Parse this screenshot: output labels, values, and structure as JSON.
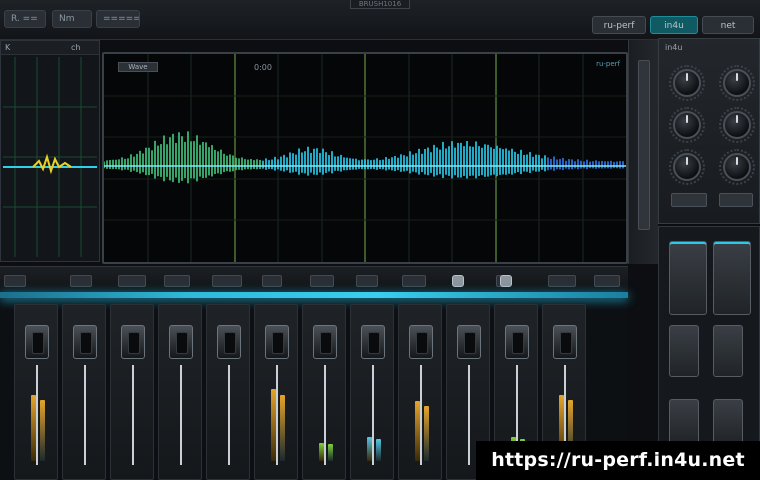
{
  "app": {
    "window_title": "BRUSH1016",
    "toolbar_items": [
      "R. ==",
      "Nm",
      "====="
    ],
    "right_badges": [
      "ru-perf",
      "in4u",
      "net"
    ]
  },
  "overview": {
    "tabs": [
      "K",
      "ch"
    ]
  },
  "waveform": {
    "title": "Wave",
    "position_readout": "0:00",
    "corner_label": "ru-perf"
  },
  "knobs": {
    "header": "in4u"
  },
  "mixer": {
    "channel_count": 12,
    "meter_levels": [
      0.55,
      0.0,
      0.0,
      0.0,
      0.0,
      0.6,
      0.15,
      0.2,
      0.5,
      0.0,
      0.2,
      0.55
    ],
    "meter_colors": [
      "#e6a52a",
      "#2ab5d9",
      "#2ab5d9",
      "#2ab5d9",
      "#2ab5d9",
      "#e6a52a",
      "#7ed23a",
      "#56c7e6",
      "#e6a52a",
      "#2ab5d9",
      "#7ed23a",
      "#e6a52a"
    ]
  },
  "colors": {
    "accent": "#2fb9da",
    "wave_cyan": "#27c7e8",
    "wave_blue": "#2b74e0",
    "wave_green": "#3fc07a",
    "meter_amber": "#e6a52a"
  },
  "watermark": {
    "text": "https://ru-perf.in4u.net"
  }
}
